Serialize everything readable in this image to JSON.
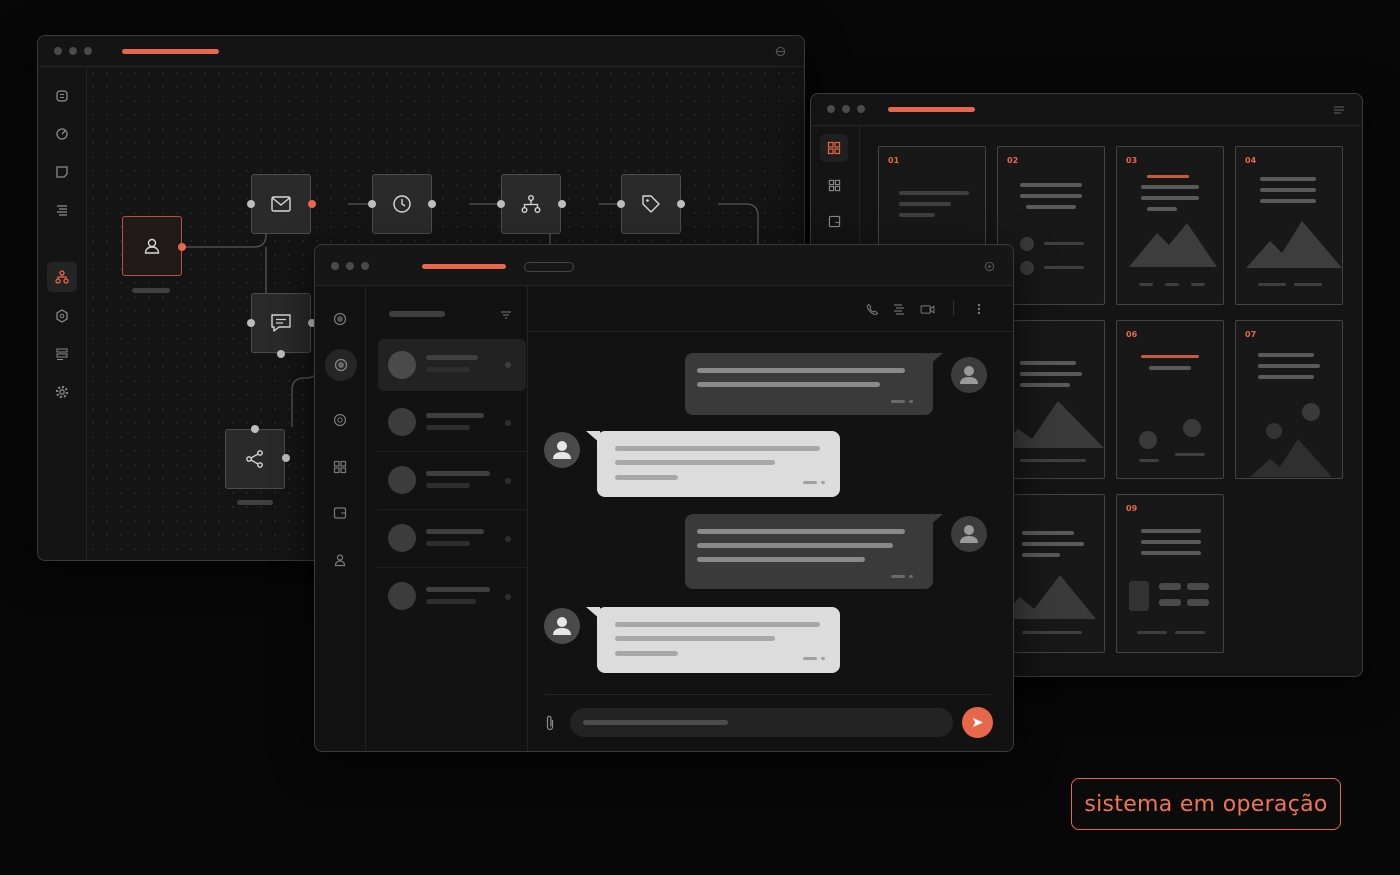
{
  "workflow_window": {
    "sidebar": {
      "items": [
        {
          "icon": "stack-icon"
        },
        {
          "icon": "gauge-icon"
        },
        {
          "icon": "note-icon"
        },
        {
          "icon": "list-icon"
        },
        {
          "icon": "flow-icon",
          "active": true
        },
        {
          "icon": "hexagon-icon"
        },
        {
          "icon": "sliders-icon"
        },
        {
          "icon": "gear-icon"
        }
      ]
    },
    "nodes": [
      {
        "icon": "user-icon",
        "active": true
      },
      {
        "icon": "mail-icon"
      },
      {
        "icon": "clock-icon"
      },
      {
        "icon": "hierarchy-icon"
      },
      {
        "icon": "tag-icon"
      },
      {
        "icon": "chat-icon"
      },
      {
        "icon": "share-icon"
      }
    ]
  },
  "templates_window": {
    "cards": [
      {
        "num": "01"
      },
      {
        "num": "02"
      },
      {
        "num": "03"
      },
      {
        "num": "04"
      },
      {
        "num": "06"
      },
      {
        "num": "07"
      },
      {
        "num": "09"
      }
    ]
  },
  "chat_window": {
    "toolbar": {
      "icons": [
        "phone-icon",
        "list-icon",
        "video-icon",
        "more-icon"
      ]
    },
    "conversation_count": 5
  },
  "badge": {
    "label": "sistema em operação"
  },
  "colors": {
    "accent": "#e8674a",
    "background": "#070707"
  }
}
